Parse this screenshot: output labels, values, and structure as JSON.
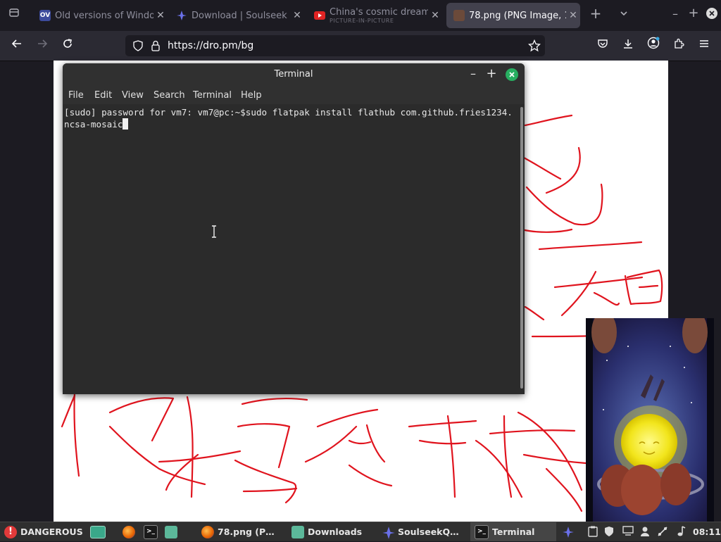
{
  "browser": {
    "tabs": [
      {
        "title": "Old versions of Windo",
        "favicon": "ov",
        "favicon_color": "#3d4b9c",
        "active": false
      },
      {
        "title": "Download | Soulseek",
        "favicon": "bird-icon",
        "favicon_color": "#5a62d6",
        "active": false
      },
      {
        "title": "China's cosmic dream |",
        "subtitle": "PICTURE-IN-PICTURE",
        "favicon": "youtube-icon",
        "favicon_color": "#e02424",
        "active": false
      },
      {
        "title": "78.png (PNG Image, 10",
        "favicon": "image-icon",
        "favicon_color": "#6b4a3a",
        "active": true
      }
    ],
    "url": "https://dro.pm/bg"
  },
  "terminal": {
    "title": "Terminal",
    "menu": [
      "File",
      "Edit",
      "View",
      "Search",
      "Terminal",
      "Help"
    ],
    "content": "[sudo] password for vm7: vm7@pc:~$sudo flatpak install flathub com.github.fries1234.ncsa-mosaic"
  },
  "taskbar": {
    "start_label": "DANGEROUS",
    "windows": [
      {
        "label": "78.png (P…",
        "icon": "firefox-icon"
      },
      {
        "label": "Downloads",
        "icon": "folder-icon"
      },
      {
        "label": "SoulseekQ…",
        "icon": "bird-icon"
      },
      {
        "label": "Terminal",
        "icon": "terminal-icon",
        "active": true
      }
    ],
    "clock": "08:11"
  },
  "colors": {
    "accent_green": "#27ae60",
    "pen_red": "#e0141e",
    "browser_bg": "#1c1b22"
  }
}
